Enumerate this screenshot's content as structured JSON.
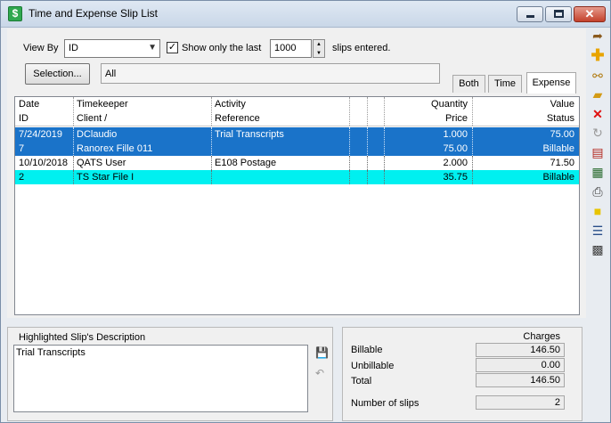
{
  "window": {
    "title": "Time and Expense Slip List",
    "icon_glyph": "$",
    "close_glyph": "✕"
  },
  "filters": {
    "view_by_label": "View By",
    "view_by_value": "ID",
    "show_only_label": "Show only the last",
    "show_only_checked": true,
    "check_glyph": "✓",
    "count_value": "1000",
    "slips_entered_label": "slips entered.",
    "selection_button": "Selection...",
    "selection_value": "All"
  },
  "tabs": [
    {
      "label": "Both",
      "active": false
    },
    {
      "label": "Time",
      "active": false
    },
    {
      "label": "Expense",
      "active": true
    }
  ],
  "table": {
    "header1": [
      "Date",
      "Timekeeper",
      "Activity",
      "Quantity",
      "Value"
    ],
    "header2": [
      "ID",
      "Client /",
      "Reference",
      "Price",
      "Status"
    ],
    "rows": [
      {
        "date": "7/24/2019",
        "timekeeper": "DClaudio",
        "activity": "Trial Transcripts",
        "quantity": "1.000",
        "value": "75.00",
        "id": "7",
        "client": "Ranorex Fille 011",
        "reference": "",
        "price": "75.00",
        "status": "Billable",
        "highlight": "selected"
      },
      {
        "date": "10/10/2018",
        "timekeeper": "QATS User",
        "activity": "E108 Postage",
        "quantity": "2.000",
        "value": "71.50",
        "id": "2",
        "client": "TS Star File I",
        "reference": "",
        "price": "35.75",
        "status": "Billable",
        "highlight": "cyan"
      }
    ]
  },
  "description": {
    "title": "Highlighted Slip's Description",
    "text": "Trial Transcripts"
  },
  "charges": {
    "header": "Charges",
    "billable_label": "Billable",
    "billable": "146.50",
    "unbillable_label": "Unbillable",
    "unbillable": "0.00",
    "total_label": "Total",
    "total": "146.50",
    "slips_label": "Number of slips",
    "slips": "2"
  },
  "toolbar_icons": [
    "walk-in-icon",
    "add-icon",
    "links-icon",
    "open-folder-icon",
    "delete-icon",
    "refresh-icon",
    "book-icon",
    "report-icon",
    "print-icon",
    "note-icon",
    "list-icon",
    "calculator-icon"
  ],
  "colors": {
    "selected_row": "#1a73c9",
    "cyan_row": "#00f0f0"
  }
}
